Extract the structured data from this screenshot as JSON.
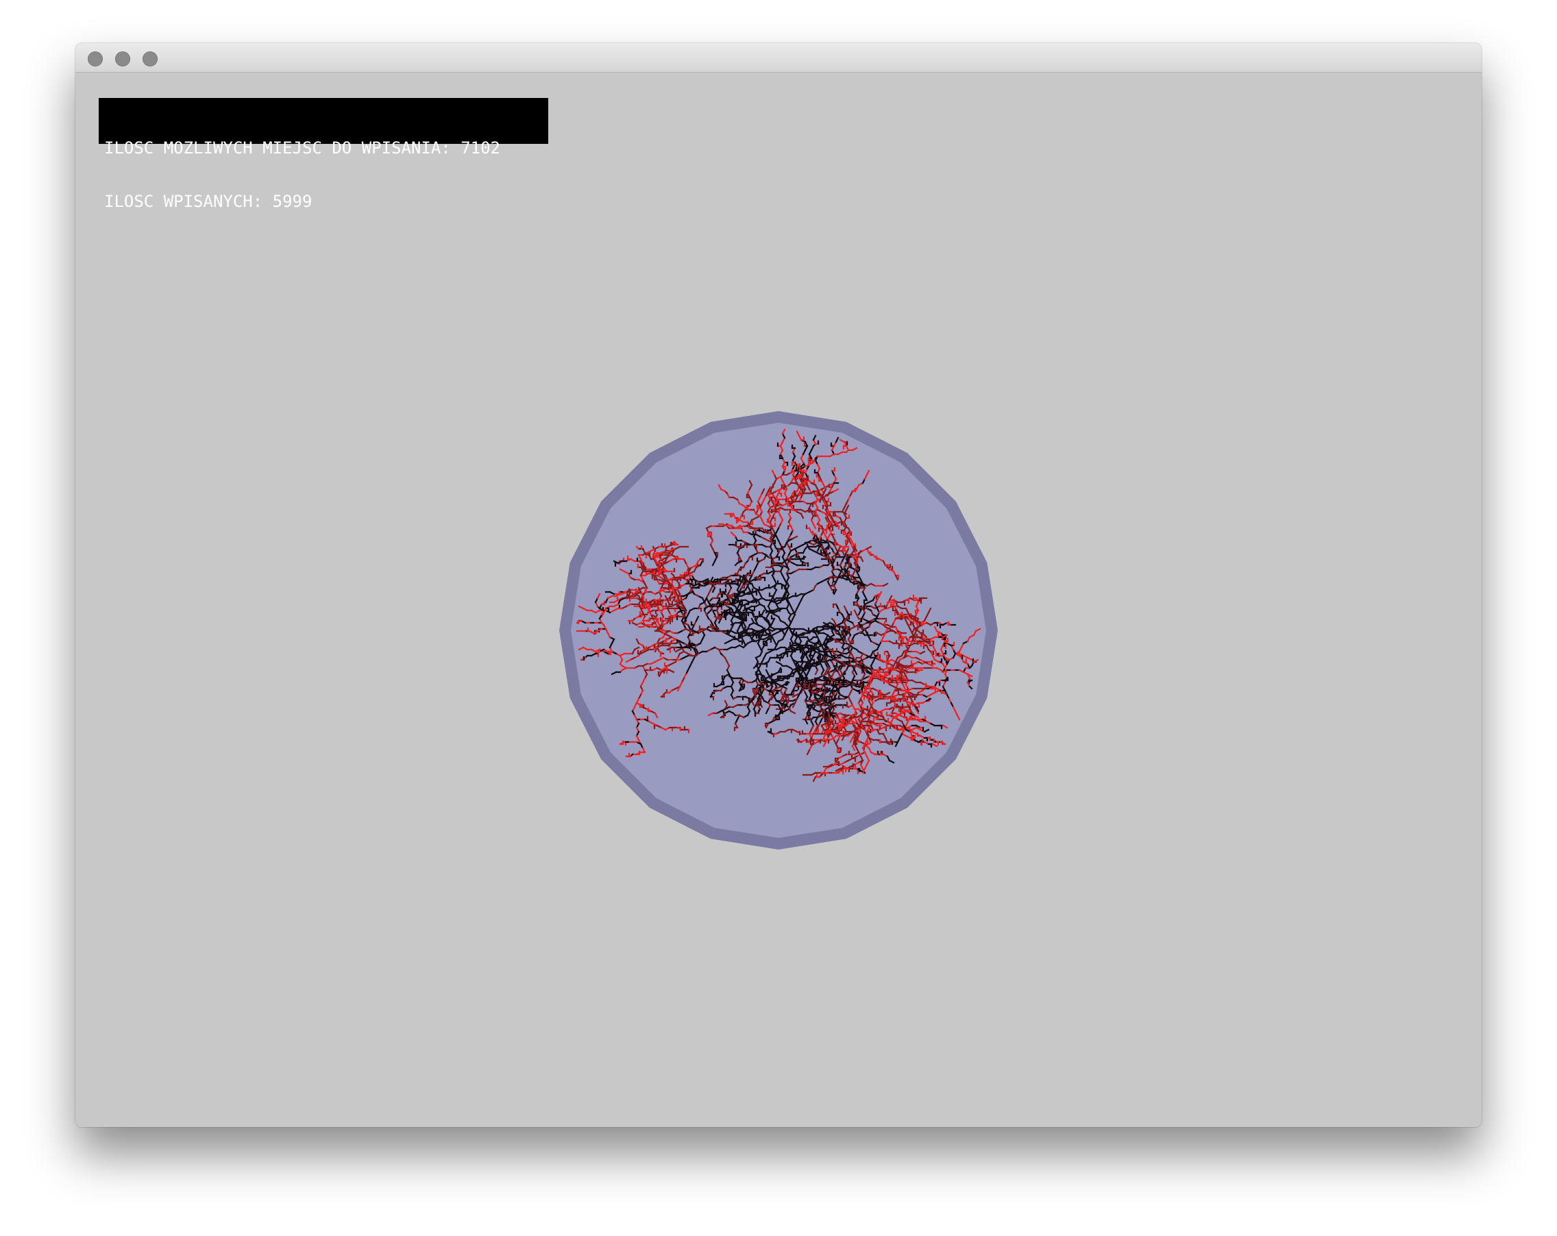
{
  "window": {
    "title": "",
    "controls": [
      "close-button",
      "minimize-button",
      "zoom-button"
    ]
  },
  "hud": {
    "possible_sites_label": "ILOSC MOZLIWYCH MIEJSC DO WPISANIA:",
    "possible_sites_value": "7102",
    "inscribed_label": "ILOSC WPISANYCH:",
    "inscribed_value": "5999"
  },
  "colors": {
    "background": "#c8c8c8",
    "circle_fill": "#9a9bc1",
    "circle_rim": "#7a7aa3",
    "old_particles": "#120c12",
    "mid_particles": "#8a1a1a",
    "new_particles": "#ee2222",
    "hud_background": "#000000",
    "hud_text": "#ffffff"
  },
  "simulation": {
    "description_visible": false,
    "aggregate_colors": [
      "#120c12",
      "#8a1a1a",
      "#ee2222"
    ]
  }
}
